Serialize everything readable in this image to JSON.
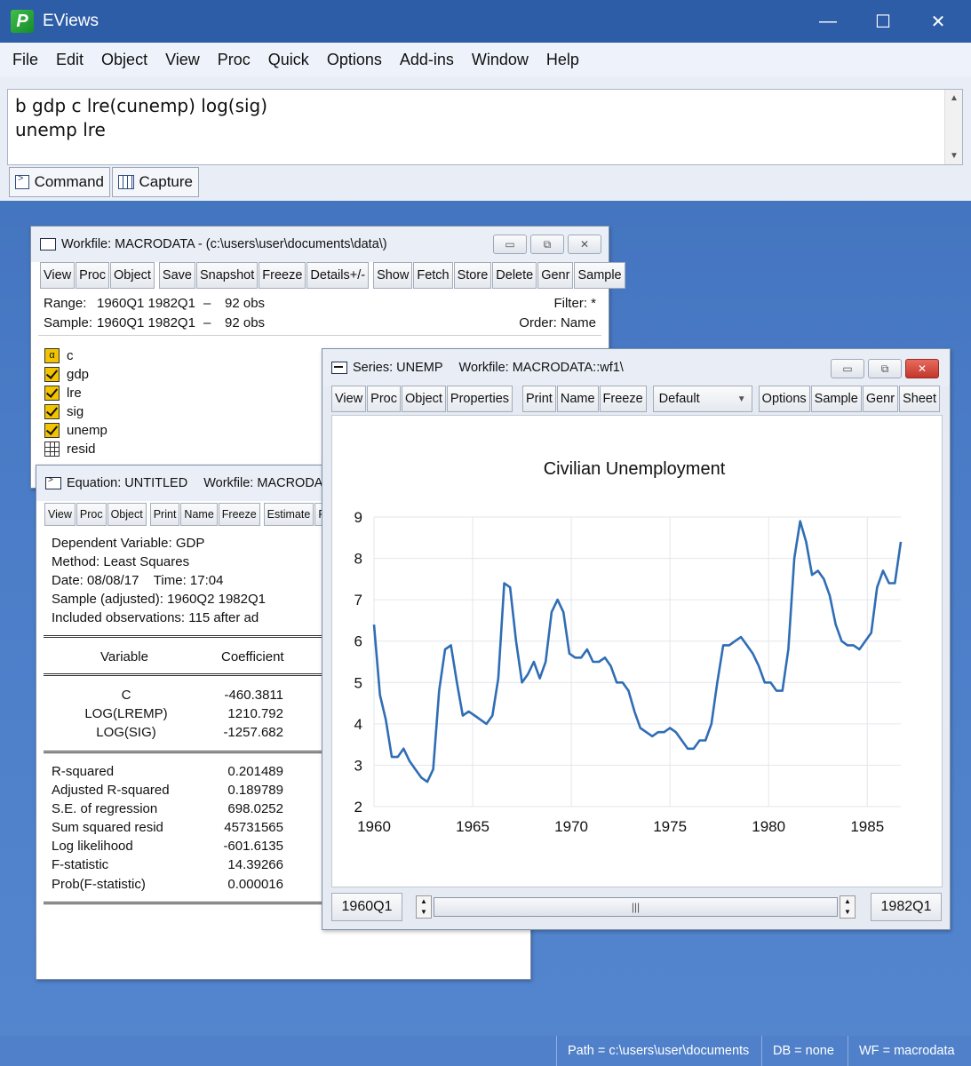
{
  "app": {
    "title": "EViews",
    "logo_letter": "P"
  },
  "window_controls": {
    "minimize": "—",
    "maximize": "☐",
    "close": "✕"
  },
  "menu": [
    "File",
    "Edit",
    "Object",
    "View",
    "Proc",
    "Quick",
    "Options",
    "Add-ins",
    "Window",
    "Help"
  ],
  "command": {
    "lines": [
      "b gdp c lre(cunemp) log(sig)",
      "unemp lre"
    ],
    "tabs": [
      "Command",
      "Capture"
    ]
  },
  "workfile": {
    "title": "Workfile: MACRODATA - (c:\\users\\user\\documents\\data\\)",
    "toolbar": [
      "View",
      "Proc",
      "Object",
      "Save",
      "Snapshot",
      "Freeze",
      "Details+/-",
      "Show",
      "Fetch",
      "Store",
      "Delete",
      "Genr",
      "Sample"
    ],
    "range_label": "Range:",
    "range_value": "1960Q1 1982Q1",
    "range_dash": "–",
    "range_obs": "92 obs",
    "sample_label": "Sample:",
    "sample_value": "1960Q1 1982Q1",
    "sample_dash": "–",
    "sample_obs": "92 obs",
    "filter": "Filter: *",
    "order": "Order: Name",
    "objects": [
      {
        "name": "c",
        "icon": "alpha-icon"
      },
      {
        "name": "gdp",
        "icon": "series-check-icon"
      },
      {
        "name": "lre",
        "icon": "series-check-icon"
      },
      {
        "name": "sig",
        "icon": "series-check-icon"
      },
      {
        "name": "unemp",
        "icon": "series-check-icon"
      },
      {
        "name": "resid",
        "icon": "table-icon"
      }
    ]
  },
  "equation": {
    "title_left": "Equation: UNTITLED",
    "title_right": "Workfile: MACRODATA",
    "toolbar": [
      "View",
      "Proc",
      "Object",
      "Print",
      "Name",
      "Freeze",
      "Estimate",
      "Fore"
    ],
    "header": [
      "Dependent Variable: GDP",
      "Method: Least Squares",
      "Date: 08/08/17    Time: 17:04",
      "Sample (adjusted): 1960Q2 1982Q1",
      "Included observations: 115 after ad"
    ],
    "col_variable": "Variable",
    "col_coefficient": "Coefficient",
    "rows": [
      {
        "variable": "C",
        "coefficient": "-460.3811"
      },
      {
        "variable": "LOG(LREMP)",
        "coefficient": "1210.792"
      },
      {
        "variable": "LOG(SIG)",
        "coefficient": "-1257.682"
      }
    ],
    "stats": [
      {
        "label": "R-squared",
        "value": "0.201489"
      },
      {
        "label": "Adjusted R-squared",
        "value": "0.189789"
      },
      {
        "label": "S.E. of regression",
        "value": "698.0252"
      },
      {
        "label": "Sum squared resid",
        "value": "45731565"
      },
      {
        "label": "Log likelihood",
        "value": "-601.6135"
      },
      {
        "label": "F-statistic",
        "value": "14.39266"
      },
      {
        "label": "Prob(F-statistic)",
        "value": "0.000016"
      }
    ]
  },
  "series_window": {
    "title_left": "Series: UNEMP",
    "title_right": "Workfile: MACRODATA::wf1\\",
    "toolbar_left": [
      "View",
      "Proc",
      "Object",
      "Properties"
    ],
    "toolbar_mid": [
      "Print",
      "Name",
      "Freeze"
    ],
    "dropdown_value": "Default",
    "toolbar_right": [
      "Options",
      "Sample",
      "Genr",
      "Sheet"
    ],
    "scroll_start": "1960Q1",
    "scroll_end": "1982Q1"
  },
  "chart_data": {
    "type": "line",
    "title": "Civilian Unemployment",
    "xlabel": "",
    "ylabel": "",
    "xlim": [
      1960,
      1986.7
    ],
    "ylim": [
      2,
      9
    ],
    "grid": true,
    "x_ticks": [
      "1960",
      "1965",
      "1970",
      "1975",
      "1980",
      "1985"
    ],
    "y_ticks": [
      "2",
      "3",
      "4",
      "5",
      "6",
      "7",
      "8",
      "9"
    ],
    "color": "#2f6db5",
    "series": [
      {
        "x": [
          1960.0,
          1960.3,
          1960.6,
          1960.9,
          1961.2,
          1961.5,
          1961.8,
          1962.1,
          1962.4,
          1962.7,
          1963.0,
          1963.3,
          1963.6,
          1963.9,
          1964.2,
          1964.5,
          1964.8,
          1965.1,
          1965.4,
          1965.7,
          1966.0,
          1966.3,
          1966.6,
          1966.9,
          1967.2,
          1967.5,
          1967.8,
          1968.1,
          1968.4,
          1968.7,
          1969.0,
          1969.3,
          1969.6,
          1969.9,
          1970.2,
          1970.5,
          1970.8,
          1971.1,
          1971.4,
          1971.7,
          1972.0,
          1972.3,
          1972.6,
          1972.9,
          1973.2,
          1973.5,
          1973.8,
          1974.1,
          1974.4,
          1974.7,
          1975.0,
          1975.3,
          1975.6,
          1975.9,
          1976.2,
          1976.5,
          1976.8,
          1977.1,
          1977.4,
          1977.7,
          1978.0,
          1978.3,
          1978.6,
          1978.9,
          1979.2,
          1979.5,
          1979.8,
          1980.1,
          1980.4,
          1980.7,
          1981.0,
          1981.3,
          1981.6,
          1981.9,
          1982.2,
          1982.5,
          1982.8,
          1983.1,
          1983.4,
          1983.7,
          1984.0,
          1984.3,
          1984.6,
          1984.9,
          1985.2,
          1985.5,
          1985.8,
          1986.1,
          1986.4,
          1986.7
        ],
        "values": [
          6.4,
          4.7,
          4.1,
          3.2,
          3.2,
          3.4,
          3.1,
          2.9,
          2.7,
          2.6,
          2.9,
          4.8,
          5.8,
          5.9,
          5.0,
          4.2,
          4.3,
          4.2,
          4.1,
          4.0,
          4.2,
          5.1,
          7.4,
          7.3,
          6.0,
          5.0,
          5.2,
          5.5,
          5.1,
          5.5,
          6.7,
          7.0,
          6.7,
          5.7,
          5.6,
          5.6,
          5.8,
          5.5,
          5.5,
          5.6,
          5.4,
          5.0,
          5.0,
          4.8,
          4.3,
          3.9,
          3.8,
          3.7,
          3.8,
          3.8,
          3.9,
          3.8,
          3.6,
          3.4,
          3.4,
          3.6,
          3.6,
          4.0,
          5.0,
          5.9,
          5.9,
          6.0,
          6.1,
          5.9,
          5.7,
          5.4,
          5.0,
          5.0,
          4.8,
          4.8,
          5.8,
          8.0,
          8.9,
          8.4,
          7.6,
          7.7,
          7.5,
          7.1,
          6.4,
          6.0,
          5.9,
          5.9,
          5.8,
          6.0,
          6.2,
          7.3,
          7.7,
          7.4,
          7.4,
          8.4
        ]
      }
    ]
  },
  "statusbar": {
    "path": "Path = c:\\users\\user\\documents",
    "db": "DB = none",
    "wf": "WF = macrodata"
  }
}
